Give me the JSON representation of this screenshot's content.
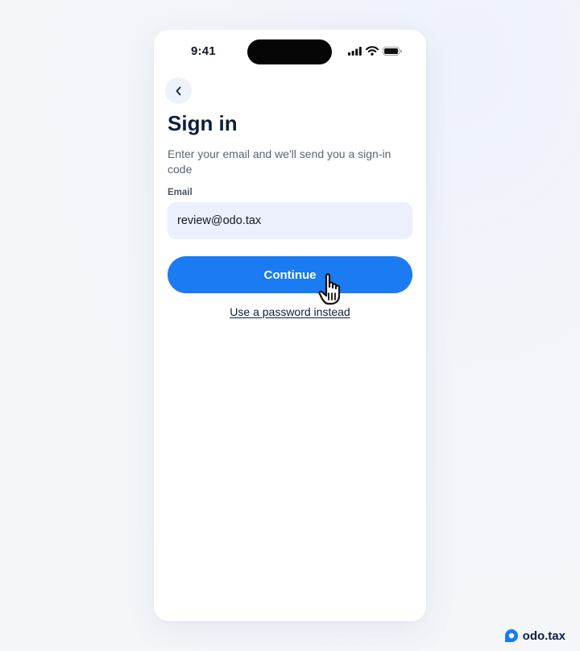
{
  "status_bar": {
    "time": "9:41"
  },
  "screen": {
    "back_icon": "chevron-left-icon",
    "title": "Sign in",
    "subtitle": "Enter your email and we'll send you a sign-in code",
    "email": {
      "label": "Email",
      "value": "review@odo.tax"
    },
    "continue_label": "Continue",
    "password_link": "Use a password instead"
  },
  "branding": {
    "name": "odo.tax",
    "logo_icon": "odo-logo-icon"
  },
  "colors": {
    "accent": "#1a7bf2",
    "title": "#0f1f3d",
    "input_bg": "#ebf0fc",
    "background": "#f4f6fa"
  }
}
